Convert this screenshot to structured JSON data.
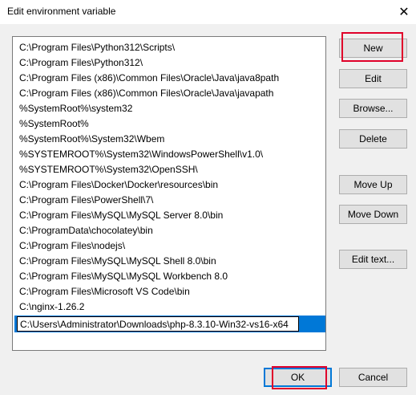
{
  "window": {
    "title": "Edit environment variable",
    "close_glyph": "✕"
  },
  "paths": [
    "C:\\Program Files\\Python312\\Scripts\\",
    "C:\\Program Files\\Python312\\",
    "C:\\Program Files (x86)\\Common Files\\Oracle\\Java\\java8path",
    "C:\\Program Files (x86)\\Common Files\\Oracle\\Java\\javapath",
    "%SystemRoot%\\system32",
    "%SystemRoot%",
    "%SystemRoot%\\System32\\Wbem",
    "%SYSTEMROOT%\\System32\\WindowsPowerShell\\v1.0\\",
    "%SYSTEMROOT%\\System32\\OpenSSH\\",
    "C:\\Program Files\\Docker\\Docker\\resources\\bin",
    "C:\\Program Files\\PowerShell\\7\\",
    "C:\\Program Files\\MySQL\\MySQL Server 8.0\\bin",
    "C:\\ProgramData\\chocolatey\\bin",
    "C:\\Program Files\\nodejs\\",
    "C:\\Program Files\\MySQL\\MySQL Shell 8.0\\bin",
    "C:\\Program Files\\MySQL\\MySQL Workbench 8.0",
    "C:\\Program Files\\Microsoft VS Code\\bin",
    "C:\\nginx-1.26.2"
  ],
  "editing": {
    "value": "C:\\Users\\Administrator\\Downloads\\php-8.3.10-Win32-vs16-x64"
  },
  "buttons": {
    "new": "New",
    "edit": "Edit",
    "browse": "Browse...",
    "delete": "Delete",
    "move_up": "Move Up",
    "move_down": "Move Down",
    "edit_text": "Edit text...",
    "ok": "OK",
    "cancel": "Cancel"
  },
  "colors": {
    "selection": "#0078d7",
    "highlight": "#e0002a"
  }
}
